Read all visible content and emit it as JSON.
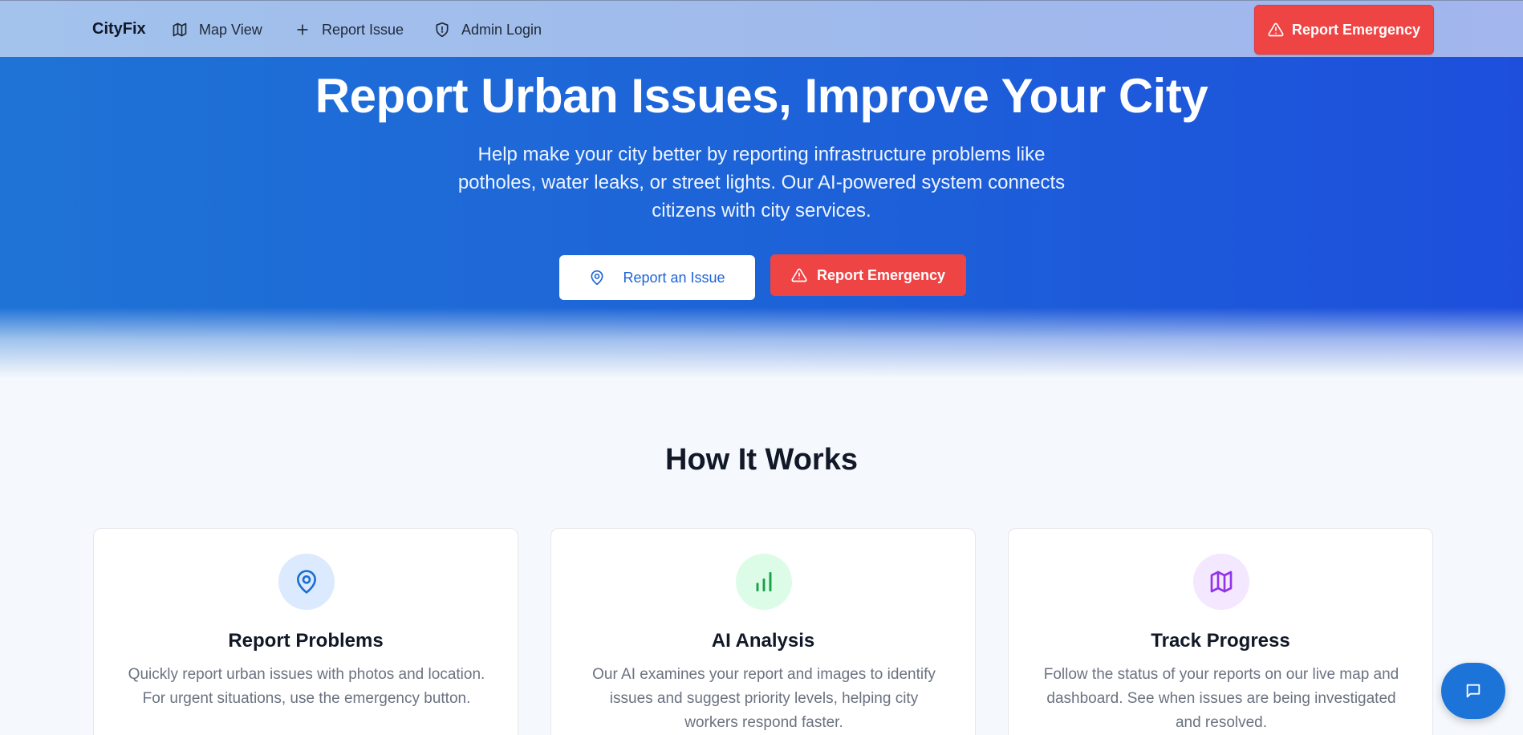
{
  "nav": {
    "brand": "CityFix",
    "links": [
      {
        "label": "Map View",
        "icon": "map-icon"
      },
      {
        "label": "Report Issue",
        "icon": "plus-icon"
      },
      {
        "label": "Admin Login",
        "icon": "shield-icon"
      }
    ],
    "emergency_label": "Report Emergency"
  },
  "hero": {
    "title": "Report Urban Issues, Improve Your City",
    "subtitle": "Help make your city better by reporting infrastructure problems like potholes, water leaks, or street lights. Our AI-powered system connects citizens with city services.",
    "report_issue_label": "Report an Issue",
    "emergency_label": "Report Emergency"
  },
  "how_it_works": {
    "title": "How It Works",
    "cards": [
      {
        "title": "Report Problems",
        "description": "Quickly report urban issues with photos and location. For urgent situations, use the emergency button.",
        "icon": "map-pin-icon",
        "icon_color": "#1d6fd6",
        "icon_bg": "#dbeafe"
      },
      {
        "title": "AI Analysis",
        "description": "Our AI examines your report and images to identify issues and suggest priority levels, helping city workers respond faster.",
        "icon": "bar-chart-icon",
        "icon_color": "#16a34a",
        "icon_bg": "#dcfce7"
      },
      {
        "title": "Track Progress",
        "description": "Follow the status of your reports on our live map and dashboard. See when issues are being investigated and resolved.",
        "icon": "map-icon",
        "icon_color": "#9333ea",
        "icon_bg": "#f3e8ff"
      }
    ]
  },
  "colors": {
    "accent": "#1d63d8",
    "emergency": "#ef4444"
  },
  "chat": {
    "icon": "chat-icon"
  }
}
